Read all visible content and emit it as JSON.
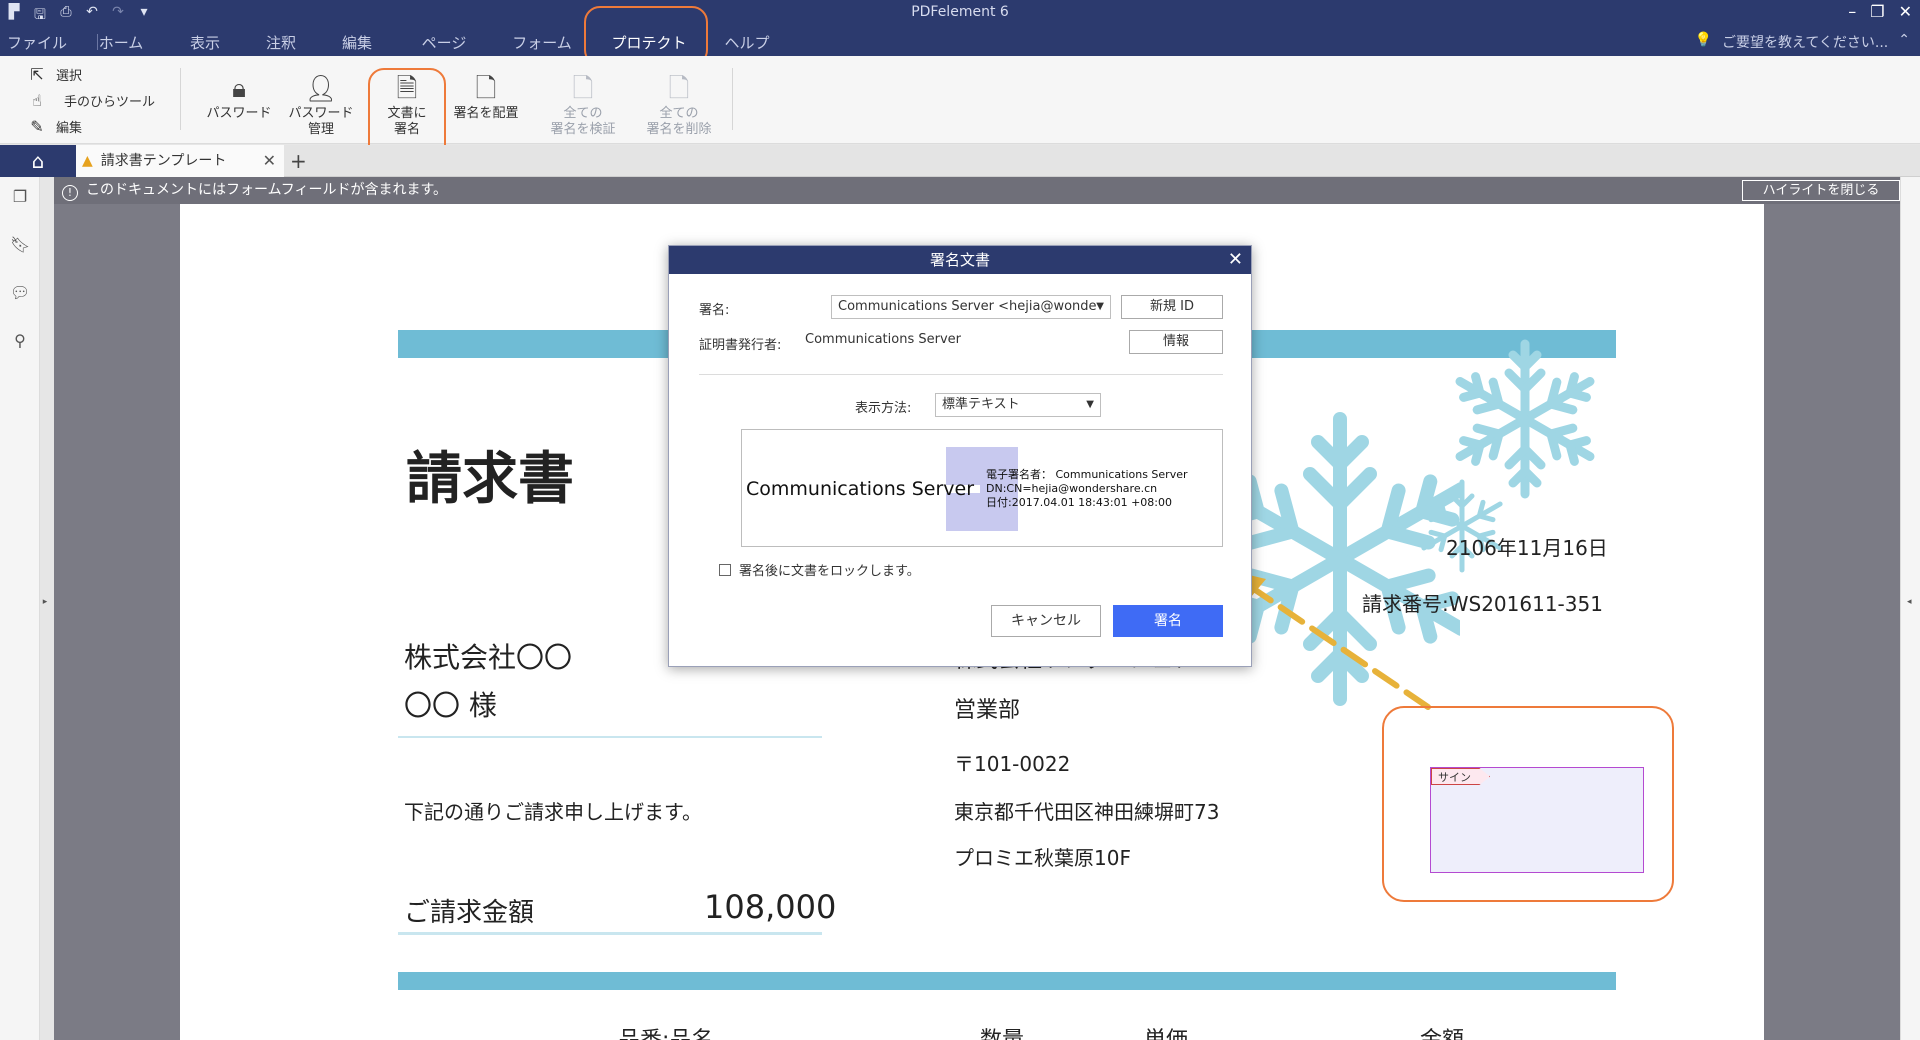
{
  "app": {
    "title": "PDFelement 6"
  },
  "quick_access": [
    "app-icon",
    "save-icon",
    "print-icon",
    "undo-icon",
    "redo-icon",
    "customize-icon"
  ],
  "menu": {
    "items": [
      "ファイル",
      "ホーム",
      "表示",
      "注釈",
      "編集",
      "ページ",
      "フォーム",
      "プロテクト",
      "ヘルプ"
    ],
    "active": "プロテクト"
  },
  "help_prompt": "ご要望を教えてください...",
  "ribbon": {
    "tools": [
      "選択",
      "手のひらツール",
      "編集"
    ],
    "password": "パスワード",
    "password_mgmt_1": "パスワード",
    "password_mgmt_2": "管理",
    "sign_doc_1": "文書に",
    "sign_doc_2": "署名",
    "place_sig": "署名を配置",
    "verify_all_1": "全ての",
    "verify_all_2": "署名を検証",
    "delete_all_1": "全ての",
    "delete_all_2": "署名を削除"
  },
  "tabs": {
    "doc_tab": "請求書テンプレート",
    "add": "+"
  },
  "info_bar": {
    "message": "このドキュメントにはフォームフィールドが含まれます。",
    "close_highlight": "ハイライトを閉じる"
  },
  "document": {
    "title": "請求書",
    "date": "2106年11月16日",
    "invoice_no": "請求番号:WS201611-351",
    "company_to": "株式会社〇〇",
    "recipient": "〇〇 様",
    "sender_partial": "株式会社ワンダーシェア",
    "department": "営業部",
    "postal": "〒101-0022",
    "address": "東京都千代田区神田練塀町73",
    "building": "プロミエ秋葉原10F",
    "request_text": "下記の通りご請求申し上げます。",
    "amount_label": "ご請求金額",
    "amount_value": "108,000",
    "col_item": "品番:品名",
    "col_qty": "数量",
    "col_unit_price": "単価",
    "col_amount": "金額",
    "sign_tag": "サイン"
  },
  "dialog": {
    "title": "署名文書",
    "signature_label": "署名:",
    "signature_value": "Communications Server <hejia@wonde",
    "new_id": "新規 ID",
    "issuer_label": "証明書発行者:",
    "issuer_value": "Communications Server",
    "info": "情報",
    "display_label": "表示方法:",
    "display_value": "標準テキスト",
    "preview_name": "Communications Server",
    "preview_line1": "電子署名者： Communications Server",
    "preview_line2": "DN:CN=hejia@wondershare.cn",
    "preview_line3": "日付:2017.04.01 18:43:01 +08:00",
    "lock_label": "署名後に文書をロックします。",
    "lock_checked": false,
    "cancel": "キャンセル",
    "sign": "署名"
  },
  "colors": {
    "titlebar": "#2c3a6e",
    "accent_orange": "#ee7a3a",
    "sign_button": "#3f6bf5",
    "stripe": "#6fbcd5",
    "snowflake": "#9fd6e4"
  }
}
